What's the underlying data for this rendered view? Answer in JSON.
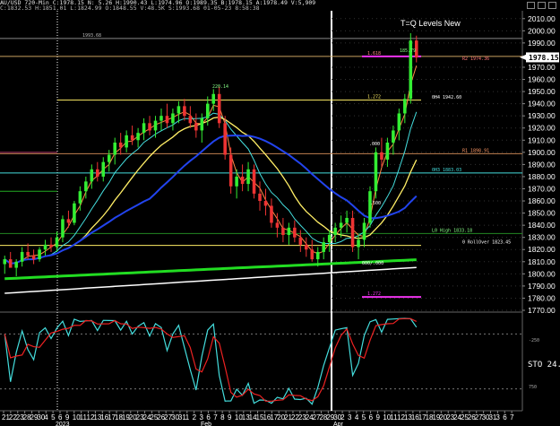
{
  "window": {
    "symbol_header": "AU/USD 720-Min  C:1978.15  N:   5.26  H:1990.43  L:1974.96  O:1989.35  B:1978.15  A:1978.49  V:5,909",
    "sub_header": "C:1832.53  H:1851.01  L:1824.99  O:1848.55  V:48.5K  S:1993.68  01-05-23  8:58:38",
    "study_title": "T=Q Levels New"
  },
  "price_axis": {
    "labels": [
      "2010.00",
      "2000.00",
      "1990.00",
      "1970.00",
      "1960.00",
      "1950.00",
      "1940.00",
      "1930.00",
      "1920.00",
      "1910.00",
      "1900.00",
      "1890.00",
      "1880.00",
      "1870.00",
      "1860.00",
      "1850.00",
      "1840.00",
      "1830.00",
      "1820.00",
      "1810.00",
      "1800.00",
      "1790.00",
      "1780.00",
      "1770.00"
    ],
    "current_price": "1978.15",
    "current_color": "#ffffff"
  },
  "levels": [
    {
      "label": "1993.68",
      "price": 1993.68
    },
    {
      "label": "1.618",
      "price": 1978.9
    },
    {
      "label": "R2 1974.36",
      "price": 1974.36
    },
    {
      "label": "1.272",
      "price": 1943.0
    },
    {
      "label": "0H4 1942.60",
      "price": 1942.6
    },
    {
      "label": "R1 1898.91",
      "price": 1898.91
    },
    {
      "label": "0H3 1883.03",
      "price": 1883.03
    },
    {
      "label": "L0 High 1833.18",
      "price": 1833.18
    },
    {
      "label": "0 RollOver 1823.45",
      "price": 1823.45
    },
    {
      "label": "1.272",
      "price": 1781.0
    }
  ],
  "annotations": {
    "peak1": "220.14",
    "peak2": "185.79",
    "mark_000": ".000",
    "mark_500": ".500",
    "mark_low": "000/.000"
  },
  "indicator": {
    "label": "STO  24.",
    "levels": [
      "-250",
      "750"
    ]
  },
  "time_axis": {
    "labels": [
      "21",
      "22",
      "23",
      "28",
      "29",
      "30",
      "4",
      "5",
      "6",
      "9",
      "10",
      "11",
      "12",
      "13",
      "16",
      "17",
      "18",
      "19",
      "20",
      "23",
      "24",
      "25",
      "26",
      "27",
      "30",
      "31",
      "1",
      "2",
      "3",
      "6",
      "7",
      "8",
      "9",
      "10",
      "13",
      "14",
      "15",
      "16",
      "17",
      "20",
      "21",
      "22",
      "23",
      "24",
      "27",
      "28",
      "29",
      "30",
      "2",
      "3",
      "4",
      "5",
      "6",
      "9",
      "10",
      "11",
      "12",
      "13",
      "16",
      "17",
      "18",
      "19",
      "20",
      "23",
      "24",
      "25",
      "26",
      "27",
      "30",
      "31",
      "3",
      "6",
      "7"
    ],
    "month_labels": [
      "2023",
      "Feb",
      "Apr"
    ]
  },
  "chart_data": {
    "type": "candlestick",
    "instrument": "AU/USD",
    "timeframe": "720-Min",
    "ylim": [
      1770,
      2015
    ],
    "candles": [
      [
        1808,
        1815,
        1800,
        1812
      ],
      [
        1812,
        1818,
        1806,
        1805
      ],
      [
        1805,
        1812,
        1798,
        1810
      ],
      [
        1810,
        1822,
        1806,
        1818
      ],
      [
        1818,
        1825,
        1812,
        1815
      ],
      [
        1815,
        1820,
        1808,
        1812
      ],
      [
        1812,
        1822,
        1810,
        1820
      ],
      [
        1820,
        1828,
        1815,
        1824
      ],
      [
        1824,
        1830,
        1818,
        1822
      ],
      [
        1822,
        1835,
        1818,
        1830
      ],
      [
        1830,
        1848,
        1826,
        1845
      ],
      [
        1845,
        1852,
        1838,
        1842
      ],
      [
        1842,
        1860,
        1840,
        1858
      ],
      [
        1858,
        1872,
        1852,
        1868
      ],
      [
        1868,
        1880,
        1862,
        1876
      ],
      [
        1876,
        1890,
        1870,
        1886
      ],
      [
        1886,
        1892,
        1876,
        1880
      ],
      [
        1880,
        1896,
        1876,
        1892
      ],
      [
        1892,
        1902,
        1884,
        1898
      ],
      [
        1898,
        1912,
        1890,
        1908
      ],
      [
        1908,
        1916,
        1898,
        1904
      ],
      [
        1904,
        1918,
        1900,
        1914
      ],
      [
        1914,
        1922,
        1906,
        1910
      ],
      [
        1910,
        1920,
        1904,
        1916
      ],
      [
        1916,
        1928,
        1910,
        1924
      ],
      [
        1924,
        1930,
        1914,
        1918
      ],
      [
        1918,
        1930,
        1912,
        1926
      ],
      [
        1926,
        1936,
        1918,
        1930
      ],
      [
        1930,
        1940,
        1920,
        1924
      ],
      [
        1924,
        1936,
        1918,
        1932
      ],
      [
        1932,
        1942,
        1924,
        1938
      ],
      [
        1938,
        1944,
        1926,
        1930
      ],
      [
        1930,
        1938,
        1920,
        1924
      ],
      [
        1924,
        1932,
        1912,
        1918
      ],
      [
        1918,
        1932,
        1908,
        1928
      ],
      [
        1928,
        1946,
        1922,
        1940
      ],
      [
        1940,
        1952,
        1934,
        1948
      ],
      [
        1948,
        1954,
        1920,
        1924
      ],
      [
        1924,
        1930,
        1894,
        1898
      ],
      [
        1898,
        1904,
        1866,
        1872
      ],
      [
        1872,
        1886,
        1862,
        1880
      ],
      [
        1880,
        1890,
        1868,
        1874
      ],
      [
        1874,
        1892,
        1868,
        1886
      ],
      [
        1886,
        1890,
        1862,
        1866
      ],
      [
        1866,
        1876,
        1852,
        1860
      ],
      [
        1860,
        1870,
        1848,
        1856
      ],
      [
        1856,
        1862,
        1838,
        1842
      ],
      [
        1842,
        1850,
        1830,
        1838
      ],
      [
        1838,
        1846,
        1826,
        1832
      ],
      [
        1832,
        1842,
        1824,
        1838
      ],
      [
        1838,
        1844,
        1826,
        1830
      ],
      [
        1830,
        1836,
        1818,
        1824
      ],
      [
        1824,
        1830,
        1814,
        1820
      ],
      [
        1820,
        1828,
        1810,
        1812
      ],
      [
        1812,
        1822,
        1806,
        1818
      ],
      [
        1818,
        1830,
        1812,
        1826
      ],
      [
        1826,
        1836,
        1818,
        1832
      ],
      [
        1832,
        1842,
        1826,
        1838
      ],
      [
        1838,
        1848,
        1830,
        1842
      ],
      [
        1842,
        1852,
        1834,
        1846
      ],
      [
        1846,
        1852,
        1818,
        1822
      ],
      [
        1822,
        1832,
        1812,
        1828
      ],
      [
        1828,
        1846,
        1822,
        1842
      ],
      [
        1842,
        1872,
        1838,
        1868
      ],
      [
        1868,
        1904,
        1862,
        1900
      ],
      [
        1900,
        1912,
        1888,
        1894
      ],
      [
        1894,
        1912,
        1888,
        1908
      ],
      [
        1908,
        1922,
        1898,
        1918
      ],
      [
        1918,
        1936,
        1910,
        1932
      ],
      [
        1932,
        1948,
        1924,
        1944
      ],
      [
        1944,
        1998,
        1940,
        1992
      ],
      [
        1992,
        1996,
        1974,
        1978
      ]
    ]
  },
  "colors": {
    "up": "#33ee33",
    "down": "#ee3333",
    "cyan": "#44dddd",
    "blue": "#2244ee",
    "yellow": "#ffee66",
    "green_ma": "#22dd22",
    "white_ma": "#ffffff",
    "orange": "#ff8844",
    "magenta": "#ee33ee"
  }
}
